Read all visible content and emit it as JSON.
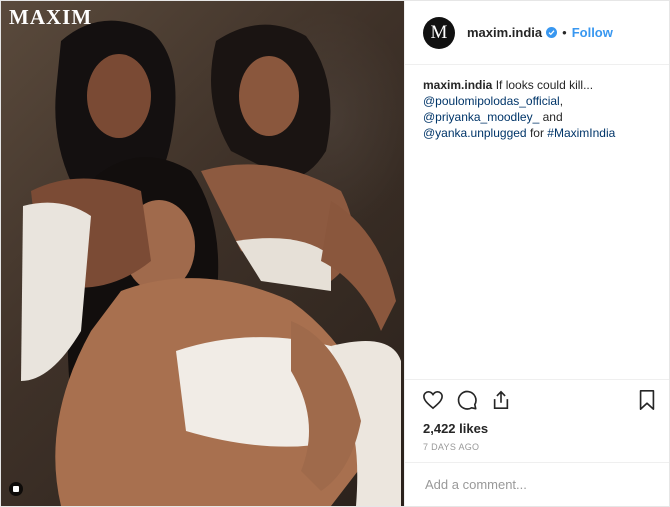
{
  "photo": {
    "masthead": "MAXIM",
    "alt_icon": "instagram-glyph-icon"
  },
  "header": {
    "avatar_letter": "M",
    "username": "maxim.india",
    "verified_icon": "verified-badge-icon",
    "separator": "•",
    "follow_label": "Follow"
  },
  "caption": {
    "username": "maxim.india",
    "text": "If looks could kill...",
    "mention_1": "@poulomipolodas_official",
    "comma": ",",
    "mention_2": "@priyanka_moodley_",
    "and": "and",
    "mention_3": "@yanka.unplugged",
    "for": "for",
    "hashtag": "#MaximIndia"
  },
  "actions": {
    "like_icon": "heart-icon",
    "comment_icon": "comment-icon",
    "share_icon": "share-icon",
    "save_icon": "bookmark-icon"
  },
  "likes": "2,422 likes",
  "age": "7 DAYS AGO",
  "comment": {
    "placeholder": "Add a comment..."
  },
  "colors": {
    "accent": "#3897f0",
    "link": "#003569",
    "muted": "#999999",
    "text": "#262626"
  }
}
